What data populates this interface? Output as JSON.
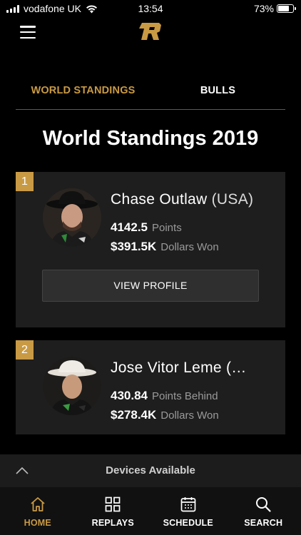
{
  "status_bar": {
    "carrier": "vodafone UK",
    "time": "13:54",
    "battery": "73%",
    "battery_level": 0.73
  },
  "tabs": [
    {
      "label": "WORLD STANDINGS",
      "active": true
    },
    {
      "label": "BULLS",
      "active": false
    }
  ],
  "page_title": "World Standings 2019",
  "standings": [
    {
      "rank": "1",
      "name": "Chase Outlaw",
      "country": "(USA)",
      "points": "4142.5",
      "points_label": "Points",
      "dollars": "$391.5K",
      "dollars_label": "Dollars Won",
      "button_label": "VIEW PROFILE"
    },
    {
      "rank": "2",
      "name": "Jose Vitor Leme (…",
      "points": "430.84",
      "points_label": "Points Behind",
      "dollars": "$278.4K",
      "dollars_label": "Dollars Won"
    }
  ],
  "devices_bar": {
    "label": "Devices Available"
  },
  "bottom_nav": [
    {
      "label": "HOME",
      "icon": "home-icon",
      "active": true
    },
    {
      "label": "REPLAYS",
      "icon": "grid-icon",
      "active": false
    },
    {
      "label": "SCHEDULE",
      "icon": "calendar-icon",
      "active": false
    },
    {
      "label": "SEARCH",
      "icon": "search-icon",
      "active": false
    }
  ],
  "colors": {
    "accent": "#c99a44",
    "background": "#000000",
    "card": "#1e1e1e"
  }
}
